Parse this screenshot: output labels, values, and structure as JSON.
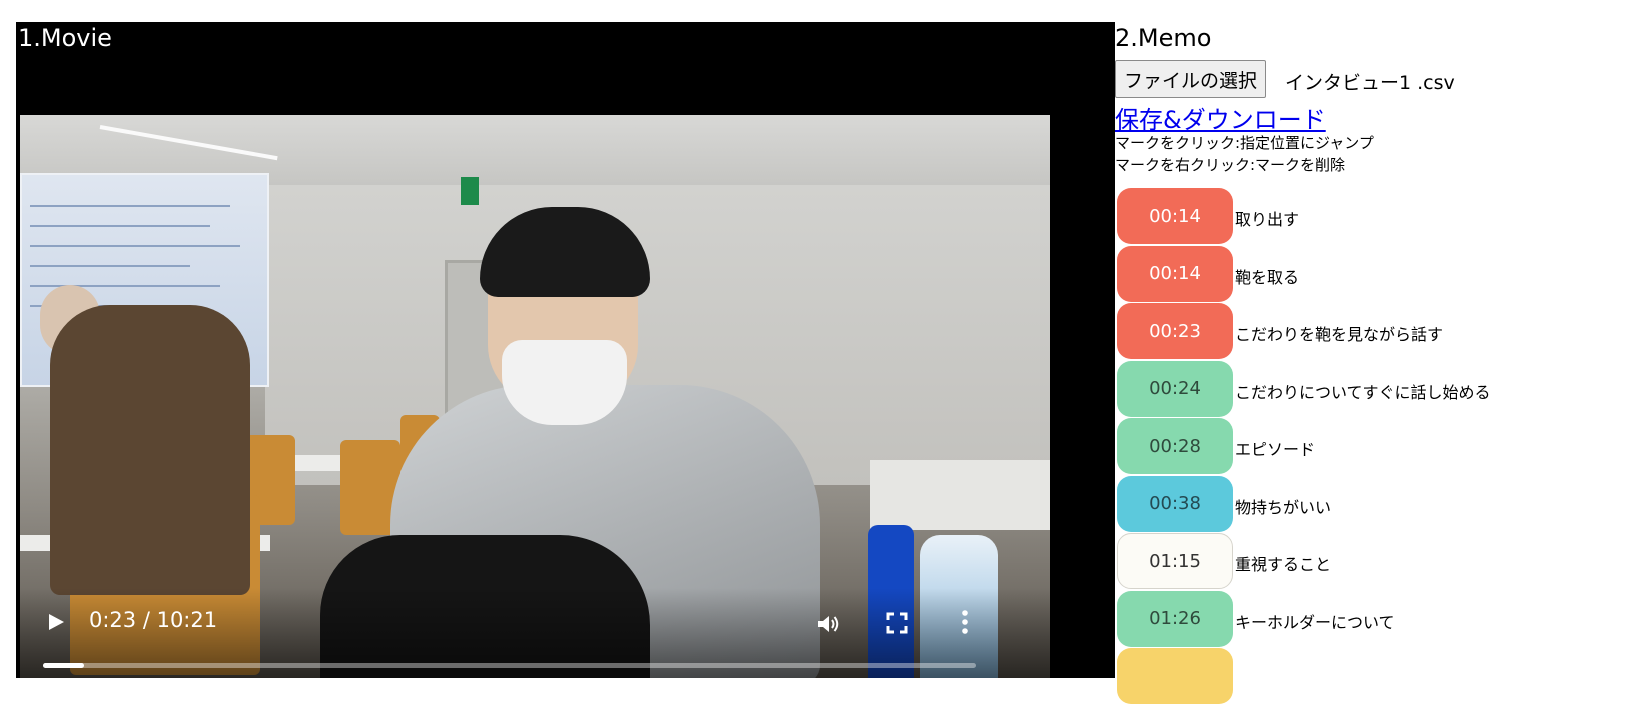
{
  "movie": {
    "title": "1.Movie",
    "time_text": "0:23 / 10:21",
    "progress_fraction": 0.044
  },
  "memo": {
    "title": "2.Memo",
    "file_button_label": "ファイルの選択",
    "file_name": "インタビュー1 .csv",
    "save_link_label": "保存&ダウンロード",
    "help_click": "マークをクリック:指定位置にジャンプ",
    "help_right_click": "マークを右クリック:マークを削除",
    "marks": [
      {
        "time": "00:14",
        "label": "取り出す",
        "color": "#f26b57",
        "text_color": "#ffffff"
      },
      {
        "time": "00:14",
        "label": "鞄を取る",
        "color": "#f26b57",
        "text_color": "#ffffff"
      },
      {
        "time": "00:23",
        "label": "こだわりを鞄を見ながら話す",
        "color": "#f26b57",
        "text_color": "#ffffff"
      },
      {
        "time": "00:24",
        "label": "こだわりについてすぐに話し始める",
        "color": "#86d9ae",
        "text_color": "#2f4a3c"
      },
      {
        "time": "00:28",
        "label": "エピソード",
        "color": "#86d9ae",
        "text_color": "#2f4a3c"
      },
      {
        "time": "00:38",
        "label": "物持ちがいい",
        "color": "#5cc9dc",
        "text_color": "#244a52"
      },
      {
        "time": "01:15",
        "label": "重視すること",
        "color": "#fcfbf6",
        "text_color": "#333333"
      },
      {
        "time": "01:26",
        "label": "キーホルダーについて",
        "color": "#86d9ae",
        "text_color": "#2f4a3c"
      },
      {
        "time": "",
        "label": "",
        "color": "#f7d36a",
        "text_color": "#333333"
      }
    ]
  }
}
